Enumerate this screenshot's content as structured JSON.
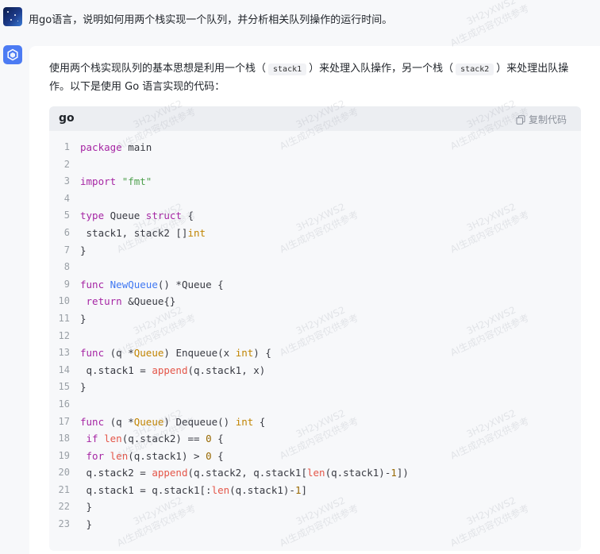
{
  "user_message": "用go语言，说明如何用两个栈实现一个队列，并分析相关队列操作的运行时间。",
  "answer": {
    "intro_part1": "使用两个栈实现队列的基本思想是利用一个栈（",
    "stack1": "stack1",
    "intro_part2": "）来处理入队操作，另一个栈（",
    "stack2": "stack2",
    "intro_part3": "）来处理出队操作。以下是使用 Go 语言实现的代码：",
    "code": {
      "language": "go",
      "copy_label": "复制代码",
      "lines": [
        {
          "n": "1",
          "text": "package main"
        },
        {
          "n": "2",
          "text": ""
        },
        {
          "n": "3",
          "text": "import \"fmt\""
        },
        {
          "n": "4",
          "text": ""
        },
        {
          "n": "5",
          "text": "type Queue struct {"
        },
        {
          "n": "6",
          "text": " stack1, stack2 []int"
        },
        {
          "n": "7",
          "text": "}"
        },
        {
          "n": "8",
          "text": ""
        },
        {
          "n": "9",
          "text": "func NewQueue() *Queue {"
        },
        {
          "n": "10",
          "text": " return &Queue{}"
        },
        {
          "n": "11",
          "text": "}"
        },
        {
          "n": "12",
          "text": ""
        },
        {
          "n": "13",
          "text": "func (q *Queue) Enqueue(x int) {"
        },
        {
          "n": "14",
          "text": " q.stack1 = append(q.stack1, x)"
        },
        {
          "n": "15",
          "text": "}"
        },
        {
          "n": "16",
          "text": ""
        },
        {
          "n": "17",
          "text": "func (q *Queue) Dequeue() int {"
        },
        {
          "n": "18",
          "text": " if len(q.stack2) == 0 {"
        },
        {
          "n": "19",
          "text": " for len(q.stack1) > 0 {"
        },
        {
          "n": "20",
          "text": " q.stack2 = append(q.stack2, q.stack1[len(q.stack1)-1])"
        },
        {
          "n": "21",
          "text": " q.stack1 = q.stack1[:len(q.stack1)-1]"
        },
        {
          "n": "22",
          "text": " }"
        },
        {
          "n": "23",
          "text": " }"
        }
      ]
    }
  },
  "watermark": {
    "line1": "3H2yXWS2",
    "line2": "AI生成内容仅供参考"
  },
  "colors": {
    "page_bg": "#f7f8fa",
    "card_bg": "#ffffff",
    "code_bg": "#f7f8fa",
    "code_header_bg": "#eceef2",
    "ai_avatar": "#4c7bf3"
  }
}
